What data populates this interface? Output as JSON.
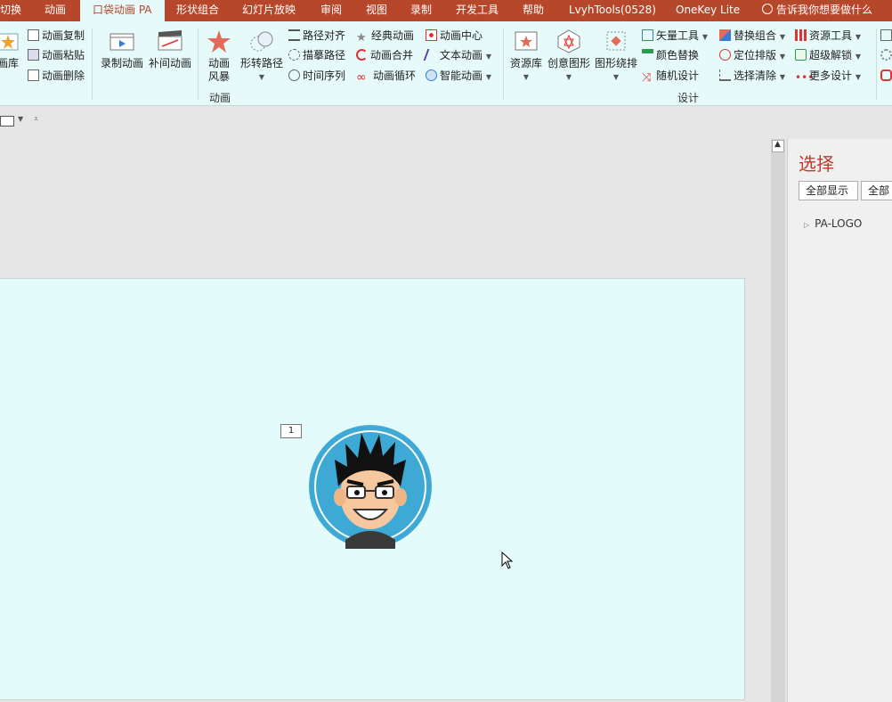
{
  "tabs": [
    {
      "label": "切换",
      "active": false
    },
    {
      "label": "动画",
      "active": false
    },
    {
      "label": "口袋动画 PA",
      "active": true
    },
    {
      "label": "形状组合",
      "active": false
    },
    {
      "label": "幻灯片放映",
      "active": false
    },
    {
      "label": "审阅",
      "active": false
    },
    {
      "label": "视图",
      "active": false
    },
    {
      "label": "录制",
      "active": false
    },
    {
      "label": "开发工具",
      "active": false
    },
    {
      "label": "帮助",
      "active": false
    },
    {
      "label": "LvyhTools(0528)",
      "active": false
    },
    {
      "label": "OneKey Lite",
      "active": false
    }
  ],
  "search": {
    "icon": "lightbulb-search-icon",
    "placeholder": "告诉我你想要做什么"
  },
  "ribbon": {
    "lib_partial": "画库",
    "copy": "动画复制",
    "paste": "动画粘贴",
    "delete": "动画删除",
    "record": "录制动画",
    "tween": "补间动画",
    "storm_line1": "动画",
    "storm_line2": "风暴",
    "morph_path": "形转路径",
    "group_anim": "动画",
    "path_align": "路径对齐",
    "draw_path": "描摹路径",
    "timeline": "时间序列",
    "classic": "经典动画",
    "merge": "动画合并",
    "loop": "动画循环",
    "center": "动画中心",
    "text_anim": "文本动画",
    "smart_anim": "智能动画",
    "resource_lib": "资源库",
    "creative": "创意图形",
    "around": "图形绕排",
    "vector": "矢量工具",
    "color_replace": "颜色替换",
    "random": "随机设计",
    "group_design": "设计",
    "replace_group": "替换组合",
    "locate": "定位排版",
    "select_clear": "选择清除",
    "resource_tools": "资源工具",
    "unlock": "超级解锁",
    "more_design": "更多设计"
  },
  "colors": {
    "accent": "#b7472a",
    "ribbon_bg": "#e6fafa",
    "slide_bg": "#e3fbfb",
    "panel_title": "#c0392b",
    "avatar_ring": "#3fa9d6"
  },
  "slide": {
    "badge": "1"
  },
  "panel": {
    "title": "选择",
    "show_all": "全部显示",
    "hide_all_partial": "全部",
    "tree_item": "PA-LOGO"
  }
}
